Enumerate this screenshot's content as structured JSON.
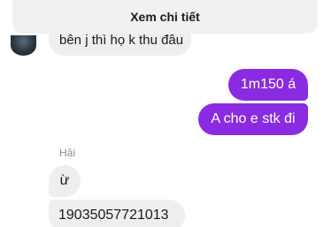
{
  "banner": {
    "label": "Xem chi tiết"
  },
  "messages": {
    "previous_incoming": "bên j thì họ k thu đâu",
    "outgoing": [
      "1m150 á",
      "A cho e stk đi"
    ],
    "sender_name": "Hải",
    "incoming": [
      "ừ",
      "19035057721013"
    ]
  },
  "colors": {
    "outgoing_bubble": "#8a2be2",
    "incoming_bubble": "#eeeeef",
    "banner_bg": "#f1f1f2"
  }
}
